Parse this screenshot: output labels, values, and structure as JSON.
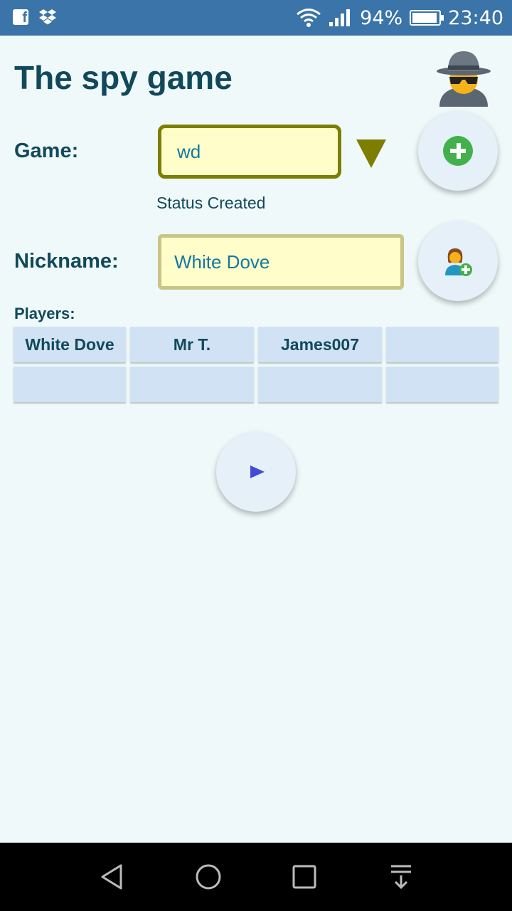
{
  "status_bar": {
    "battery_percent": "94%",
    "battery_level": 0.94,
    "time": "23:40",
    "icons": [
      "facebook-icon",
      "dropbox-icon",
      "wifi-icon",
      "signal-icon",
      "battery-icon"
    ]
  },
  "header": {
    "title": "The spy game",
    "icon": "spy-icon"
  },
  "game": {
    "label": "Game:",
    "value": "wd",
    "status": "Status Created"
  },
  "nickname": {
    "label": "Nickname:",
    "value": "White Dove"
  },
  "players": {
    "label": "Players:",
    "cells": [
      "White Dove",
      "Mr T.",
      "James007",
      "",
      "",
      "",
      "",
      ""
    ]
  },
  "colors": {
    "background": "#eff9fa",
    "status_bar": "#3a74a8",
    "text": "#12495a",
    "input_bg": "#fffecb",
    "cell_bg": "#d0e2f4",
    "accent_green": "#43b14b",
    "play_blue": "#3e4bd6"
  }
}
